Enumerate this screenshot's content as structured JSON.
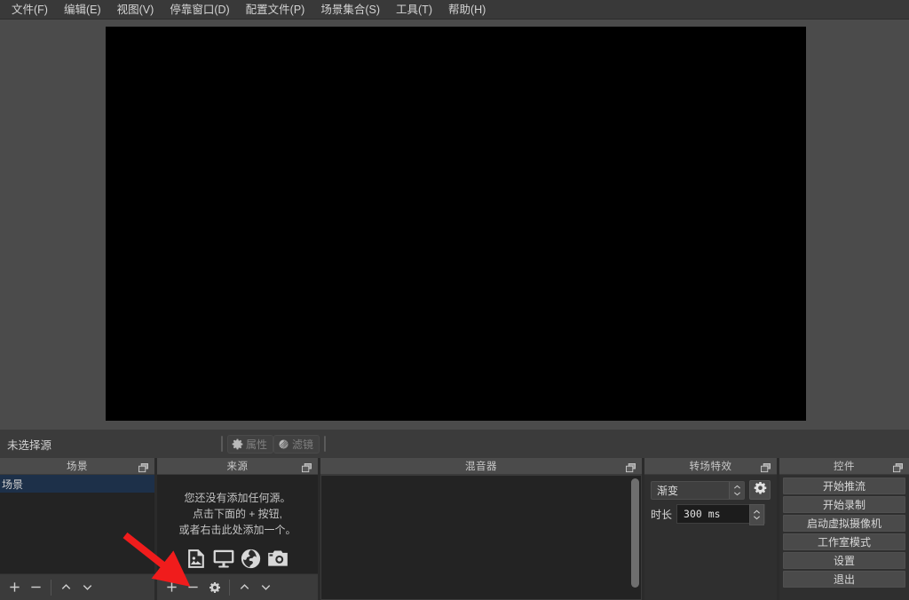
{
  "menubar": {
    "items": [
      {
        "label": "文件(F)",
        "name": "menu-file"
      },
      {
        "label": "编辑(E)",
        "name": "menu-edit"
      },
      {
        "label": "视图(V)",
        "name": "menu-view"
      },
      {
        "label": "停靠窗口(D)",
        "name": "menu-docks"
      },
      {
        "label": "配置文件(P)",
        "name": "menu-profile"
      },
      {
        "label": "场景集合(S)",
        "name": "menu-scene-collection"
      },
      {
        "label": "工具(T)",
        "name": "menu-tools"
      },
      {
        "label": "帮助(H)",
        "name": "menu-help"
      }
    ]
  },
  "preview": {
    "background_color": "#000000",
    "surround_color": "#4b4b4b"
  },
  "source_strip": {
    "status_label": "未选择源",
    "properties_label": "属性",
    "filters_label": "滤镜"
  },
  "scenes": {
    "title": "场景",
    "items": [
      {
        "label": "场景",
        "selected": true
      }
    ],
    "selection_color": "#1d3049",
    "toolbar": {
      "add": "+",
      "remove": "−",
      "move_up": "^",
      "move_down": "v"
    }
  },
  "sources": {
    "title": "来源",
    "placeholder_lines": [
      "您还没有添加任何源。",
      "点击下面的 + 按钮,",
      "或者右击此处添加一个。"
    ],
    "placeholder_icons": [
      "image-icon",
      "display-icon",
      "browser-icon",
      "camera-icon"
    ],
    "toolbar": {
      "add": "+",
      "remove": "−",
      "properties": "gear",
      "move_up": "^",
      "move_down": "v"
    }
  },
  "mixer": {
    "title": "混音器",
    "channels": []
  },
  "transitions": {
    "title": "转场特效",
    "selected_transition": "渐变",
    "duration_label": "时长",
    "duration_value": "300 ms"
  },
  "controls": {
    "title": "控件",
    "buttons": [
      {
        "label": "开始推流",
        "name": "start-streaming-button"
      },
      {
        "label": "开始录制",
        "name": "start-recording-button"
      },
      {
        "label": "启动虚拟摄像机",
        "name": "start-virtual-camera-button"
      },
      {
        "label": "工作室模式",
        "name": "studio-mode-button"
      },
      {
        "label": "设置",
        "name": "settings-button"
      },
      {
        "label": "退出",
        "name": "exit-button"
      }
    ]
  },
  "annotation": {
    "arrow_color": "#f01c1c",
    "points_to": "sources-add-button"
  }
}
